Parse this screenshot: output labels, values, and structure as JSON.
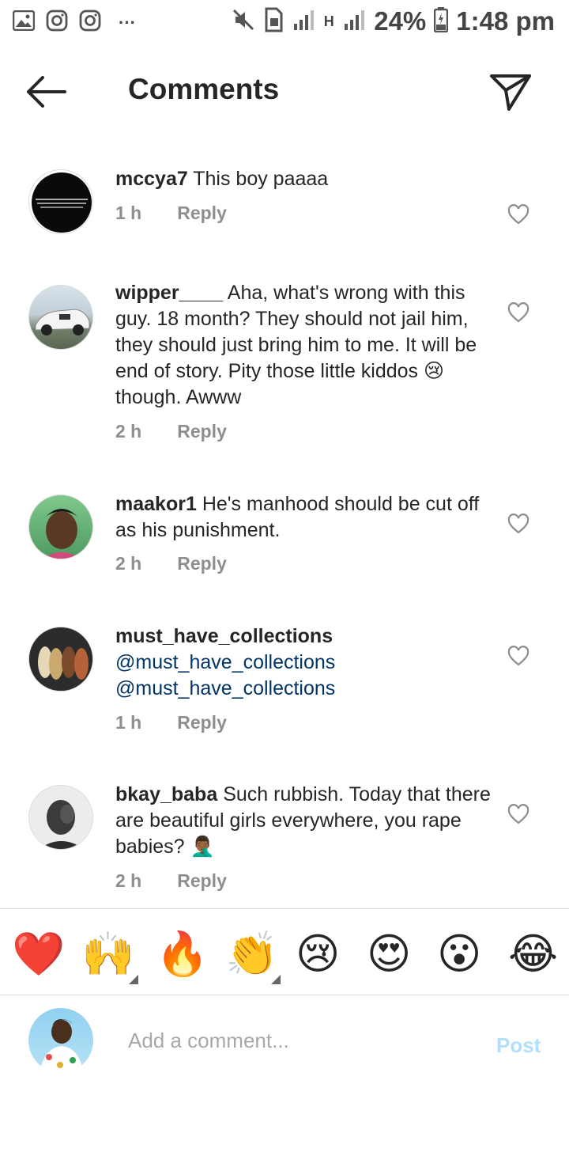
{
  "status_bar": {
    "battery": "24%",
    "time": "1:48 pm",
    "network": "H",
    "dots": "···"
  },
  "header": {
    "title": "Comments"
  },
  "comments": [
    {
      "username": "mccya7",
      "text": "This boy paaaa",
      "time": "1 h",
      "reply": "Reply"
    },
    {
      "username": "wipper____",
      "text": "Aha, what's wrong with this guy. 18 month? They should not jail him, they should just bring him to me. It will be end of story. Pity those little kiddos 😢 though. Awww",
      "time": "2 h",
      "reply": "Reply"
    },
    {
      "username": "maakor1",
      "text": "He's manhood should be cut off as his punishment.",
      "time": "2 h",
      "reply": "Reply"
    },
    {
      "username": "must_have_collections",
      "mentions": [
        "@must_have_collections",
        "@must_have_collections"
      ],
      "time": "1 h",
      "reply": "Reply"
    },
    {
      "username": "bkay_baba",
      "text": "Such rubbish.  Today that there are beautiful girls everywhere, you rape babies? 🤦🏾‍♂️",
      "time": "2 h",
      "reply": "Reply"
    }
  ],
  "emoji_bar": [
    "❤️",
    "🙌",
    "🔥",
    "👏",
    "😢",
    "😍",
    "😮",
    "😂"
  ],
  "composer": {
    "placeholder": "Add a comment...",
    "post_label": "Post"
  },
  "colors": {
    "text": "#262626",
    "secondary": "#8e8e8e",
    "mention": "#003569",
    "post_disabled": "#b2dffc"
  }
}
